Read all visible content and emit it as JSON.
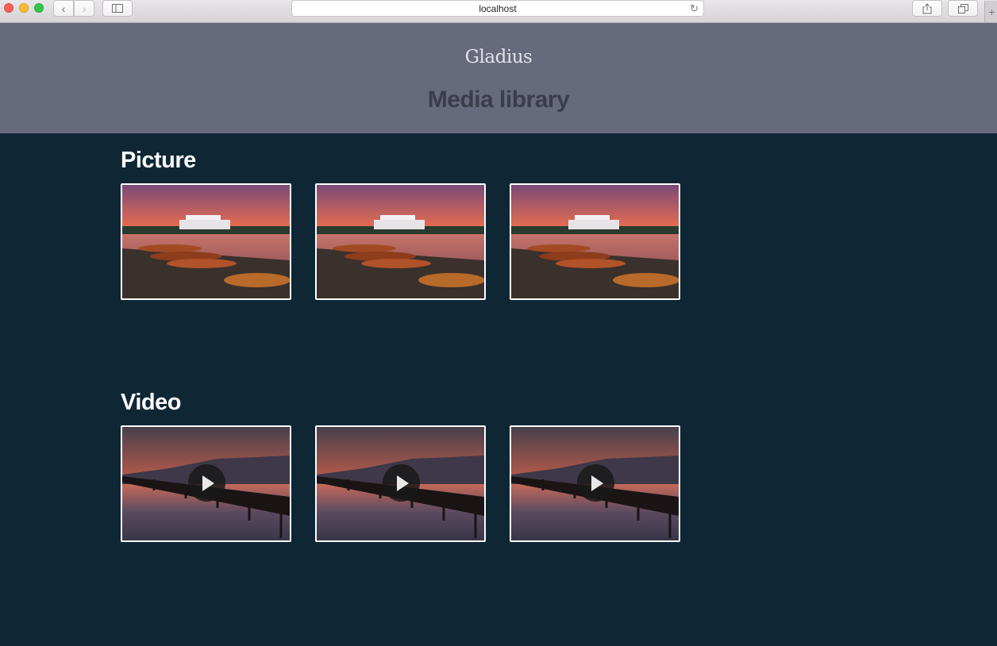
{
  "browser": {
    "url": "localhost"
  },
  "header": {
    "brand": "Gladius",
    "title": "Media library"
  },
  "sections": {
    "picture": {
      "title": "Picture",
      "items": [
        "boats-sunset",
        "boats-sunset",
        "boats-sunset"
      ]
    },
    "video": {
      "title": "Video",
      "items": [
        "jetty-sunset",
        "jetty-sunset",
        "jetty-sunset"
      ]
    }
  },
  "colors": {
    "header_bg": "#67697d",
    "page_bg": "#0f2635",
    "thumb_border": "#ffffff"
  },
  "icons": {
    "play": "play-icon"
  }
}
